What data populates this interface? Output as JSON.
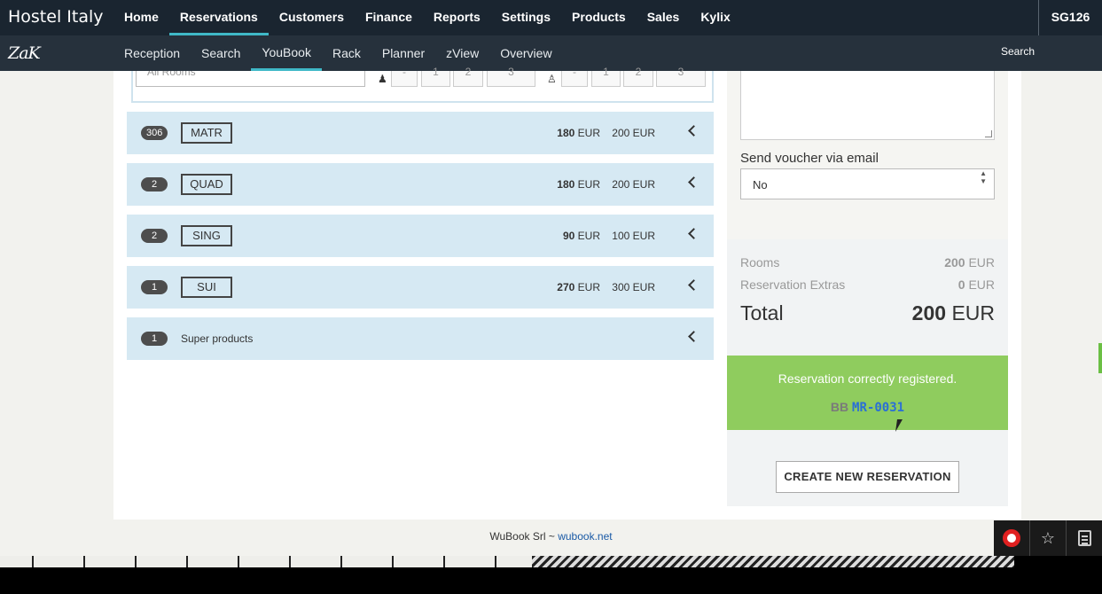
{
  "app": {
    "brand": "Hostel Italy",
    "logo": "ZaK",
    "user_id": "SG126"
  },
  "top_nav": [
    {
      "label": "Home",
      "active": false
    },
    {
      "label": "Reservations",
      "active": true
    },
    {
      "label": "Customers",
      "active": false
    },
    {
      "label": "Finance",
      "active": false
    },
    {
      "label": "Reports",
      "active": false
    },
    {
      "label": "Settings",
      "active": false
    },
    {
      "label": "Products",
      "active": false
    },
    {
      "label": "Sales",
      "active": false
    },
    {
      "label": "Kylix",
      "active": false
    }
  ],
  "sub_nav": [
    {
      "label": "Reception",
      "active": false
    },
    {
      "label": "Search",
      "active": false
    },
    {
      "label": "YouBook",
      "active": true
    },
    {
      "label": "Rack",
      "active": false
    },
    {
      "label": "Planner",
      "active": false
    },
    {
      "label": "zView",
      "active": false
    },
    {
      "label": "Overview",
      "active": false
    }
  ],
  "search_label": "Search",
  "filter": {
    "room_select": "All Rooms",
    "adult_buttons": [
      "-",
      "1",
      "2",
      "3"
    ],
    "child_buttons": [
      "-",
      "1",
      "2",
      "3"
    ]
  },
  "rooms": [
    {
      "count": "306",
      "code": "MATR",
      "price": "180",
      "price_currency": "EUR",
      "alt_price": "200 EUR"
    },
    {
      "count": "2",
      "code": "QUAD",
      "price": "180",
      "price_currency": "EUR",
      "alt_price": "200 EUR"
    },
    {
      "count": "2",
      "code": "SING",
      "price": "90",
      "price_currency": "EUR",
      "alt_price": "100 EUR"
    },
    {
      "count": "1",
      "code": "SUI",
      "price": "270",
      "price_currency": "EUR",
      "alt_price": "300 EUR"
    }
  ],
  "products_row": {
    "count": "1",
    "label": "Super products"
  },
  "voucher": {
    "label": "Send voucher via email",
    "value": "No"
  },
  "summary": {
    "rooms_label": "Rooms",
    "rooms_value": "200",
    "rooms_currency": "EUR",
    "extras_label": "Reservation Extras",
    "extras_value": "0",
    "extras_currency": "EUR",
    "total_label": "Total",
    "total_value": "200",
    "total_currency": "EUR"
  },
  "success": {
    "message": "Reservation correctly registered.",
    "code_prefix": "BB",
    "code": "MR-0031"
  },
  "create_button": "CREATE NEW RESERVATION",
  "footer": {
    "company": "WuBook Srl ~",
    "link": "wubook.net"
  },
  "colors": {
    "topbar": "#1a2530",
    "subbar": "#26313c",
    "accent": "#3fb8c7",
    "row_bg": "#d6e9f3",
    "success": "#8fcc5e"
  }
}
